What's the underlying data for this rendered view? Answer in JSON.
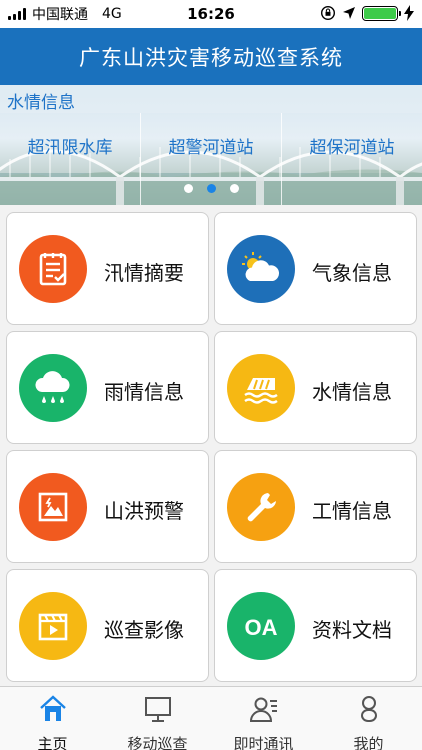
{
  "status_bar": {
    "carrier": "中国联通",
    "network": "4G",
    "time": "16:26"
  },
  "header": {
    "title": "广东山洪灾害移动巡查系统"
  },
  "banner": {
    "heading": "水情信息",
    "items": [
      "超汛限水库",
      "超警河道站",
      "超保河道站"
    ],
    "page_count": 3,
    "active_page": 2
  },
  "tiles": [
    {
      "label": "汛情摘要",
      "icon": "flood-summary-icon",
      "color": "#f15a1f"
    },
    {
      "label": "气象信息",
      "icon": "weather-icon",
      "color": "#1e6fb8"
    },
    {
      "label": "雨情信息",
      "icon": "rain-icon",
      "color": "#19b46a"
    },
    {
      "label": "水情信息",
      "icon": "water-level-icon",
      "color": "#f6b813"
    },
    {
      "label": "山洪预警",
      "icon": "flash-flood-warning-icon",
      "color": "#f15a1f"
    },
    {
      "label": "工情信息",
      "icon": "wrench-icon",
      "color": "#f6a111"
    },
    {
      "label": "巡查影像",
      "icon": "video-icon",
      "color": "#f6b813"
    },
    {
      "label": "资料文档",
      "icon": "documents-icon",
      "color": "#19b46a"
    }
  ],
  "tab_bar": {
    "tabs": [
      {
        "label": "主页",
        "icon": "home-icon",
        "active": true
      },
      {
        "label": "移动巡查",
        "icon": "monitor-icon",
        "active": false
      },
      {
        "label": "即时通讯",
        "icon": "contacts-icon",
        "active": false
      },
      {
        "label": "我的",
        "icon": "person-icon",
        "active": false
      }
    ],
    "active_color": "#1a84e6",
    "inactive_color": "#555555"
  }
}
